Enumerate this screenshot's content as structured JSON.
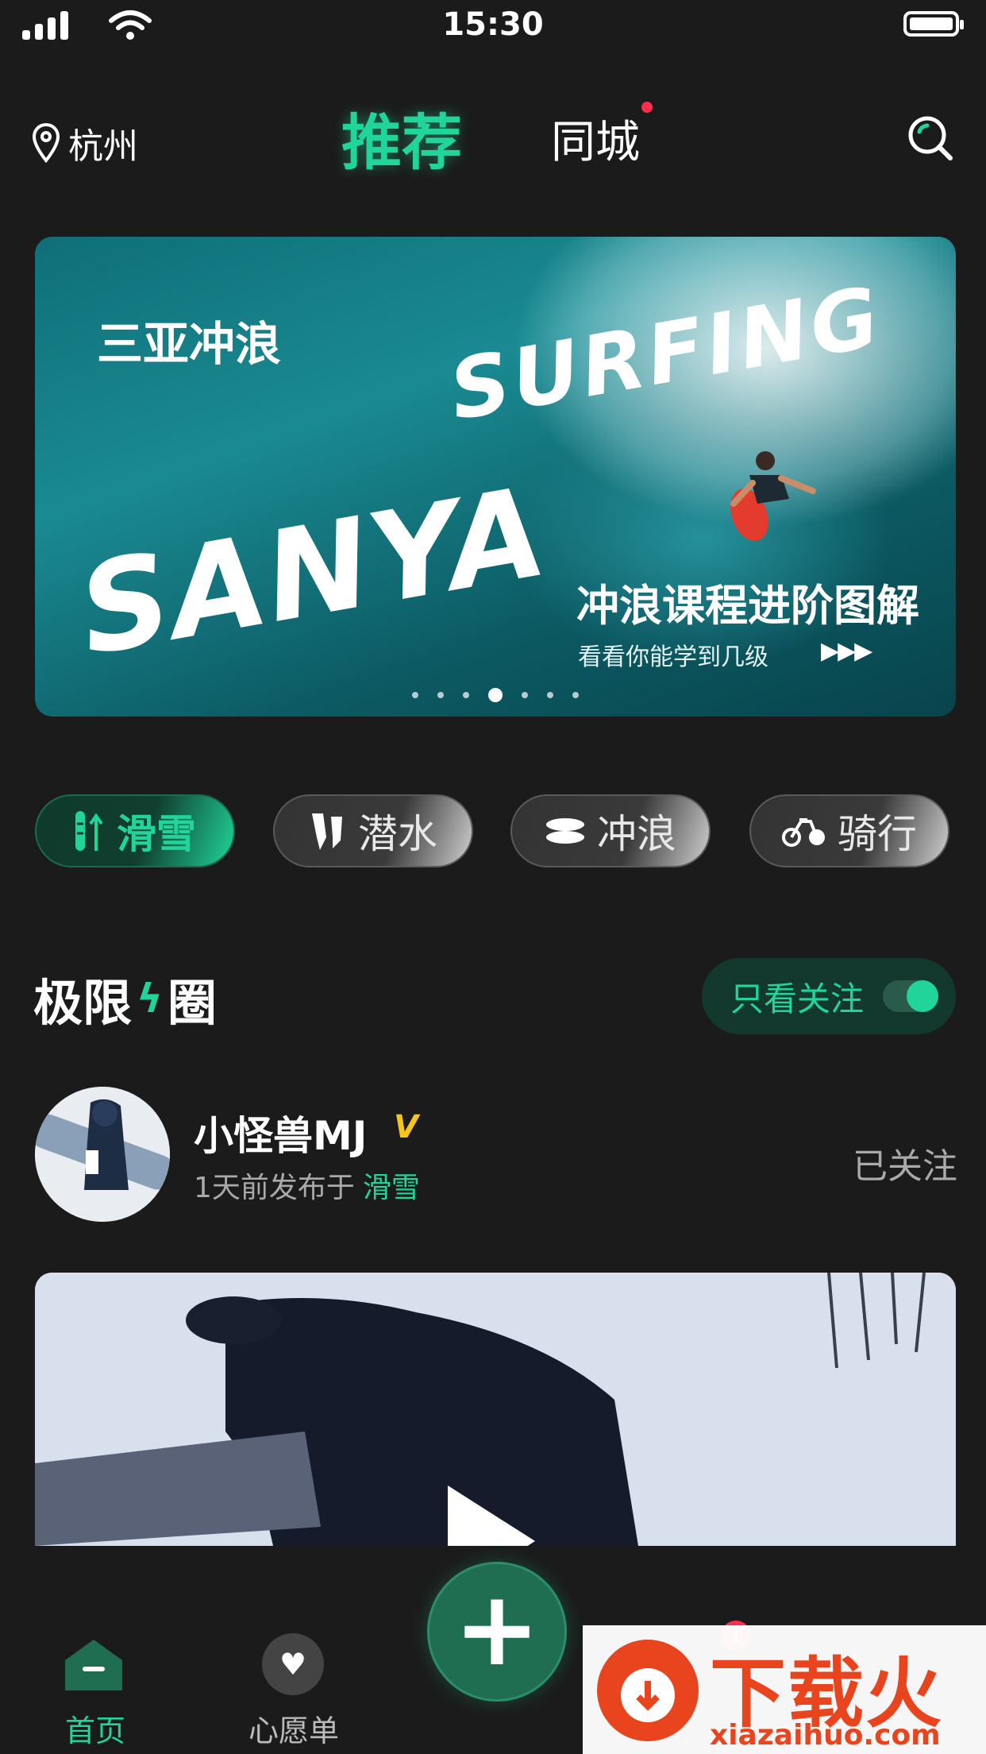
{
  "status_bar": {
    "time": "15:30"
  },
  "header": {
    "location": "杭州",
    "tabs": {
      "recommend": "推荐",
      "city": "同城"
    }
  },
  "banner": {
    "title": "三亚冲浪",
    "brush_word_1": "SURFING",
    "brush_word_2": "SANYA",
    "headline": "冲浪课程进阶图解",
    "subline": "看看你能学到几级",
    "arrows": "▶▶▶"
  },
  "categories": [
    {
      "label": "滑雪",
      "icon": "ski-icon",
      "active": true
    },
    {
      "label": "潜水",
      "icon": "fins-icon",
      "active": false
    },
    {
      "label": "冲浪",
      "icon": "surfboard-icon",
      "active": false
    },
    {
      "label": "骑行",
      "icon": "bike-icon",
      "active": false
    }
  ],
  "section": {
    "title_left": "极限",
    "title_right": "圈",
    "follow_only_label": "只看关注",
    "follow_only_on": true
  },
  "post": {
    "username": "小怪兽MJ",
    "verified_mark": "V",
    "time_prefix": "1天前发布于",
    "topic": "滑雪",
    "follow_state": "已关注"
  },
  "tabbar": {
    "home": "首页",
    "wishlist": "心愿单",
    "item3": "",
    "item4": "",
    "badge": "1"
  },
  "watermark": {
    "brand": "下载火",
    "url": "xiazaihuo.com"
  },
  "colors": {
    "accent": "#20d49a",
    "background": "#1b1b1b",
    "badge": "#ff2e4d"
  }
}
